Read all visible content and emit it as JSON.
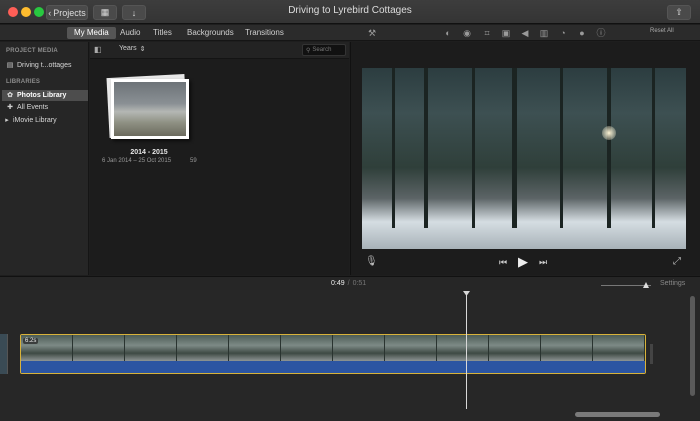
{
  "window": {
    "title": "Driving to Lyrebird Cottages"
  },
  "toolbar": {
    "projects_label": "Projects"
  },
  "tabs": [
    {
      "label": "My Media"
    },
    {
      "label": "Audio"
    },
    {
      "label": "Titles"
    },
    {
      "label": "Backgrounds"
    },
    {
      "label": "Transitions"
    }
  ],
  "sidebar": {
    "project_media_header": "PROJECT MEDIA",
    "project_item": "Driving t...ottages",
    "libraries_header": "LIBRARIES",
    "items": [
      {
        "label": "Photos Library"
      },
      {
        "label": "All Events"
      },
      {
        "label": "iMovie Library"
      }
    ]
  },
  "browser": {
    "group_by": "Years",
    "search_placeholder": "Search",
    "album": {
      "title": "2014 - 2015",
      "dates": "6 Jan 2014 – 25 Oct 2015",
      "count": "59"
    }
  },
  "viewer": {
    "reset_label": "Reset All"
  },
  "timeline": {
    "current_time": "0:49",
    "separator": "/",
    "total_time": "0:51",
    "settings_label": "Settings",
    "clip_duration": "6.2s"
  },
  "icons": {
    "back": "chevron-left-icon",
    "media": "film-strip-icon",
    "import": "download-icon",
    "share": "share-icon"
  }
}
